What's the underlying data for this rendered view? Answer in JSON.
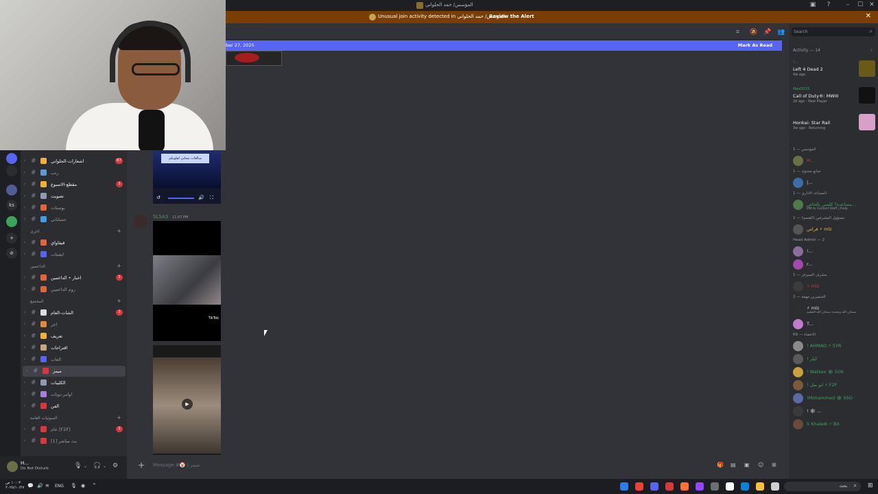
{
  "window": {
    "title": "المؤسس/ حمد الحلواني",
    "minimize": "–",
    "maximize": "☐",
    "close": "✕"
  },
  "alert": {
    "text": "Unusual join activity detected in المؤسس/ حمد الحلواني",
    "action": "Review the Alert",
    "close": "✕"
  },
  "new_messages_bar": {
    "date_fragment": "ber 27, 2025",
    "mark_as_read": "Mark As Read"
  },
  "servers": [
    {
      "label": ""
    },
    {
      "label": ""
    },
    {
      "label": ""
    },
    {
      "label": "ks"
    },
    {
      "label": ""
    },
    {
      "label": "+"
    },
    {
      "label": "⊘"
    }
  ],
  "channels": [
    {
      "name": "اشعارات-الحلواني",
      "badge": "67",
      "color": "#f0b232",
      "bright": true
    },
    {
      "name": "رتب",
      "badge": "",
      "color": "#5b9bd5",
      "bright": false
    },
    {
      "name": "مقطع-الاسبوع",
      "badge": "1",
      "color": "#f0b232",
      "bright": true
    },
    {
      "name": "تصويت",
      "badge": "",
      "color": "#8f9bb3",
      "bright": true
    },
    {
      "name": "بوستات",
      "badge": "",
      "color": "#e0663a",
      "bright": false
    },
    {
      "name": "حساباتي",
      "badge": "",
      "color": "#3ba0e5",
      "bright": false
    },
    {
      "category": "اخرى"
    },
    {
      "name": "قيفاواي",
      "badge": "",
      "color": "#e0663a",
      "bright": true
    },
    {
      "name": "ايفنتات",
      "badge": "",
      "color": "#5865f2",
      "bright": false
    },
    {
      "category": "الداعمين"
    },
    {
      "name": "اخبار • الداعمين",
      "badge": "1",
      "color": "#e0663a",
      "bright": true
    },
    {
      "name": "روم الداعمين",
      "badge": "",
      "color": "#e0663a",
      "bright": false
    },
    {
      "category": "المجتمع"
    },
    {
      "name": "الشات-العام",
      "badge": "2",
      "color": "#dbdee1",
      "bright": true
    },
    {
      "name": "اخر",
      "badge": "",
      "color": "#e08a3a",
      "bright": false
    },
    {
      "name": "تعريف",
      "badge": "",
      "color": "#f0b232",
      "bright": true
    },
    {
      "name": "اقتراحات",
      "badge": "",
      "color": "#c9a67a",
      "bright": true
    },
    {
      "name": "العاب",
      "badge": "",
      "color": "#5865f2",
      "bright": false
    },
    {
      "name": "ميمز",
      "badge": "",
      "color": "#da373c",
      "bright": true,
      "selected": true
    },
    {
      "name": "الكليبات",
      "badge": "",
      "color": "#8f9bb3",
      "bright": true
    },
    {
      "name": "اوامر-بوتات",
      "badge": "",
      "color": "#a87ee0",
      "bright": false
    },
    {
      "name": "الفن",
      "badge": "",
      "color": "#da373c",
      "bright": true
    },
    {
      "category": "الصوتيات العامة"
    },
    {
      "name": "عام [F2F]",
      "badge": "1",
      "color": "#da373c",
      "bright": false
    },
    {
      "name": "بث مباشر [1]",
      "badge": "",
      "color": "#da373c",
      "bright": false
    }
  ],
  "user_panel": {
    "name": "H...",
    "status": "Do Not Disturb"
  },
  "chat": {
    "author": "SLSA3",
    "time": "11:07 PM",
    "video1_banner": "مبالغات مجاني لقلوبكم",
    "tiktok_label": "TikTok"
  },
  "composer": {
    "placeholder": "Message #🤡 | ميمز",
    "plus": "+"
  },
  "search": {
    "placeholder": "Search"
  },
  "activity": {
    "title": "Activity — 14",
    "items": [
      {
        "user": "!...",
        "game": "Left 4 Dead 2",
        "meta": "4w ago",
        "color": "#6a5a1a"
      },
      {
        "user": "Nas0015",
        "game": "Call of Duty®: MWIII",
        "meta": "2d ago · New Player",
        "color": "#111111"
      },
      {
        "user": "",
        "game": "Honkai: Star Rail",
        "meta": "3w ago · Returning",
        "color": "#d8a0c8"
      }
    ]
  },
  "members": [
    {
      "section": "المؤسس — 1"
    },
    {
      "name": "H...",
      "color": "#da373c",
      "sub": ""
    },
    {
      "section": "صانع محتوى — 1"
    },
    {
      "name": "|...",
      "color": "#dbdee1",
      "sub": ""
    },
    {
      "section": "المساعد الاداري — 1"
    },
    {
      "name": "مساعدة؟ كلمني بالخاص...",
      "color": "#3ba55d",
      "sub": "DM to Contact Staff | /help"
    },
    {
      "section": "مسؤول المشرفين (القسم) — 1"
    },
    {
      "name": "فراس ⚡ mlz",
      "color": "#f0b232",
      "sub": ""
    },
    {
      "section": "Head Admin — 2"
    },
    {
      "name": "!...",
      "color": "#dbdee1",
      "sub": ""
    },
    {
      "name": "r...",
      "color": "#dbdee1",
      "sub": ""
    },
    {
      "section": "مشرف السيرفر — 1"
    },
    {
      "name": "⚡ mlz",
      "color": "#da373c",
      "sub": ""
    },
    {
      "section": "المتميزين مهمة — 2"
    },
    {
      "name": "⚡ mlz",
      "color": "#dbdee1",
      "sub": "سبحان الله وبحمده سبحان الله العظيم"
    },
    {
      "name": "T...",
      "color": "#dbdee1",
      "sub": ""
    },
    {
      "section": "الاعضاء — 69"
    },
    {
      "name": "! AHMAD ⚡ SYR",
      "color": "#3ba55d",
      "sub": ""
    },
    {
      "name": "! كيلر",
      "color": "#3ba55d",
      "sub": ""
    },
    {
      "name": "! Watkex 🕸 509",
      "color": "#3ba55d",
      "sub": ""
    },
    {
      "name": "! ابو مثل ⚡ F2F",
      "color": "#3ba55d",
      "sub": ""
    },
    {
      "name": "!Mohammed 🕸 SSO",
      "color": "#3ba55d",
      "sub": ""
    },
    {
      "name": "! 🕸 ...",
      "color": "#dbdee1",
      "sub": ""
    },
    {
      "name": "5 Khaledi ⚡ BX",
      "color": "#3ba55d",
      "sub": ""
    }
  ],
  "taskbar": {
    "time": "١٠:٠٣ ص",
    "date": "٢٠٢٥/١٠/٢٧",
    "lang": "ENG",
    "search": "بحث"
  }
}
